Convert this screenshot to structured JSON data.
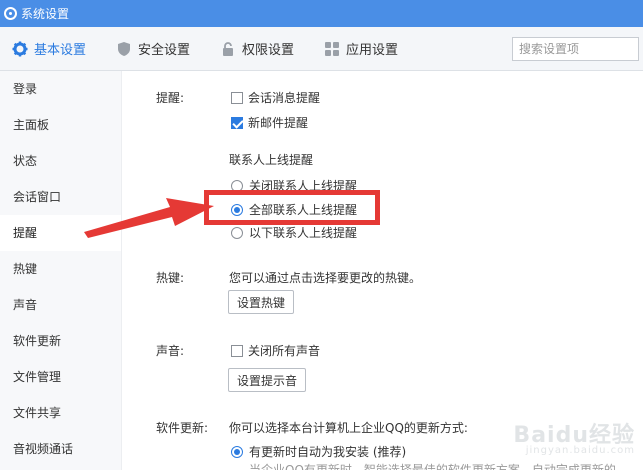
{
  "window": {
    "title": "系统设置"
  },
  "tabs": [
    {
      "label": "基本设置",
      "icon": "gear-icon"
    },
    {
      "label": "安全设置",
      "icon": "shield-icon"
    },
    {
      "label": "权限设置",
      "icon": "lock-icon"
    },
    {
      "label": "应用设置",
      "icon": "apps-icon"
    }
  ],
  "search": {
    "placeholder": "搜索设置项"
  },
  "sidebar": {
    "items": [
      {
        "label": "登录"
      },
      {
        "label": "主面板"
      },
      {
        "label": "状态"
      },
      {
        "label": "会话窗口"
      },
      {
        "label": "提醒"
      },
      {
        "label": "热键"
      },
      {
        "label": "声音"
      },
      {
        "label": "软件更新"
      },
      {
        "label": "文件管理"
      },
      {
        "label": "文件共享"
      },
      {
        "label": "音视频通话"
      }
    ],
    "active": "提醒"
  },
  "reminder": {
    "label": "提醒:",
    "chat_msg": "会话消息提醒",
    "new_mail": "新邮件提醒",
    "contact_online_title": "联系人上线提醒",
    "radio_close": "关闭联系人上线提醒",
    "radio_all": "全部联系人上线提醒",
    "radio_below": "以下联系人上线提醒"
  },
  "hotkey": {
    "label": "热键:",
    "desc": "您可以通过点击选择要更改的热键。",
    "button": "设置热键"
  },
  "sound": {
    "label": "声音:",
    "mute_all": "关闭所有声音",
    "button": "设置提示音"
  },
  "update": {
    "label": "软件更新:",
    "desc": "你可以选择本台计算机上企业QQ的更新方式:",
    "auto": "有更新时自动为我安装 (推荐)",
    "auto_sub": "当企业QQ有更新时，智能选择最佳的软件更新方案，自动完成更新的"
  },
  "watermark": {
    "brand": "Baidu经验",
    "sub": "jingyan.baidu.com"
  },
  "colors": {
    "titlebar": "#4a8ee6",
    "accent": "#2b7be0",
    "annotation": "#e53935"
  }
}
